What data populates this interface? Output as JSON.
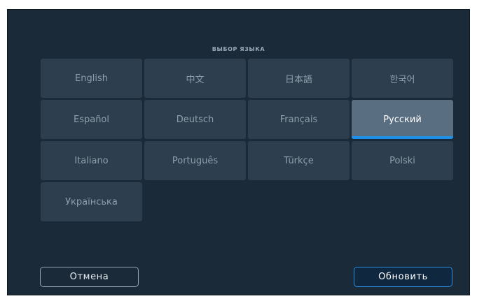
{
  "dialog": {
    "title": "ВЫБОР ЯЗЫКА"
  },
  "languages": [
    {
      "label": "English",
      "selected": false
    },
    {
      "label": "中文",
      "selected": false
    },
    {
      "label": "日本語",
      "selected": false
    },
    {
      "label": "한국어",
      "selected": false
    },
    {
      "label": "Español",
      "selected": false
    },
    {
      "label": "Deutsch",
      "selected": false
    },
    {
      "label": "Français",
      "selected": false
    },
    {
      "label": "Русский",
      "selected": true
    },
    {
      "label": "Italiano",
      "selected": false
    },
    {
      "label": "Português",
      "selected": false
    },
    {
      "label": "Türkçe",
      "selected": false
    },
    {
      "label": "Polski",
      "selected": false
    },
    {
      "label": "Українська",
      "selected": false
    }
  ],
  "buttons": {
    "cancel_label": "Отмена",
    "update_label": "Обновить"
  },
  "colors": {
    "background": "#1b2a38",
    "tile": "#2d3e4e",
    "tile_selected": "#5a6e82",
    "accent": "#1e90e8"
  }
}
